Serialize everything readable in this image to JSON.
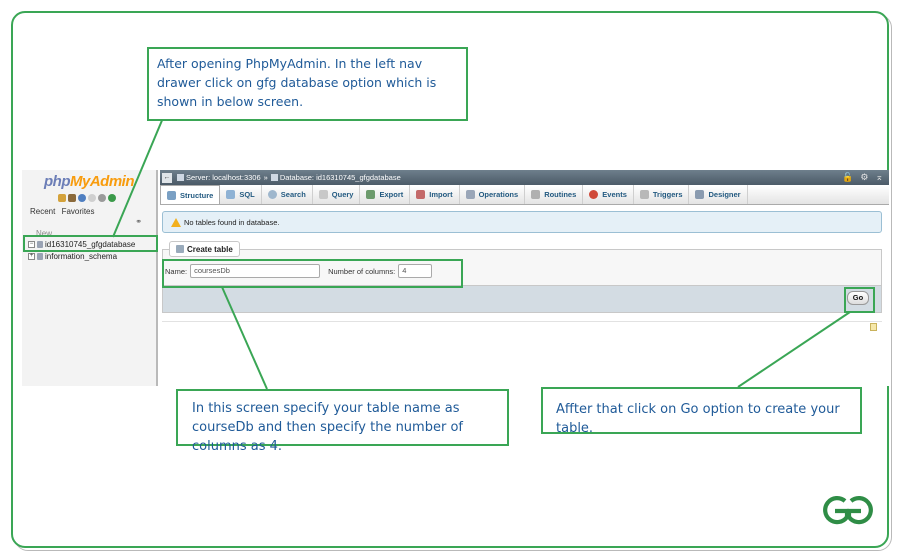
{
  "leftnav": {
    "logo_php": "php",
    "logo_my": "MyAdmin",
    "recent_label": "Recent",
    "favorites_label": "Favorites",
    "new_label": "New",
    "databases": [
      "id16310745_gfgdatabase",
      "information_schema"
    ]
  },
  "topbar": {
    "server": "Server: localhost:3306",
    "separator": "»",
    "database": "Database: id16310745_gfgdatabase"
  },
  "tabs": [
    {
      "label": "Structure",
      "icon": "structure-icon",
      "active": true
    },
    {
      "label": "SQL",
      "icon": "sql-icon"
    },
    {
      "label": "Search",
      "icon": "search-icon"
    },
    {
      "label": "Query",
      "icon": "query-icon"
    },
    {
      "label": "Export",
      "icon": "export-icon"
    },
    {
      "label": "Import",
      "icon": "import-icon"
    },
    {
      "label": "Operations",
      "icon": "wrench-icon"
    },
    {
      "label": "Routines",
      "icon": "routines-icon"
    },
    {
      "label": "Events",
      "icon": "clock-icon"
    },
    {
      "label": "Triggers",
      "icon": "triggers-icon"
    },
    {
      "label": "Designer",
      "icon": "designer-icon"
    }
  ],
  "notice": "No tables found in database.",
  "create_table": {
    "legend": "Create table",
    "name_label": "Name:",
    "name_value": "coursesDb",
    "columns_label": "Number of columns:",
    "columns_value": "4",
    "go_label": "Go"
  },
  "annotations": {
    "step1": "After opening PhpMyAdmin. In the left nav drawer click on gfg database option which is shown in below screen.",
    "step2": "In this screen specify your table name as courseDb and then specify the number of columns as 4.",
    "step3": "Affter that click on Go option to create your table."
  },
  "colors": {
    "accent_green": "#3aa655",
    "annotation_text": "#1f5a98",
    "tab_text": "#235a81"
  }
}
